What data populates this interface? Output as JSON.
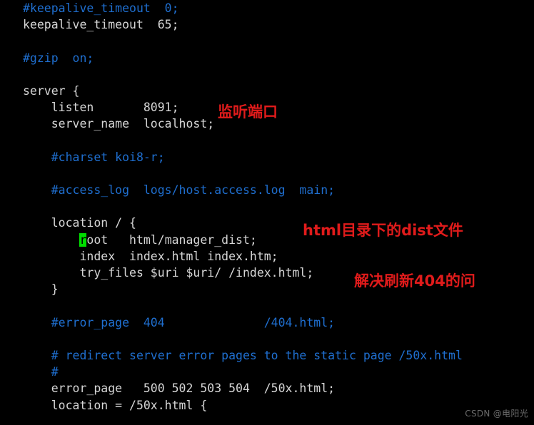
{
  "window": {
    "kind": "terminal-text-editor",
    "background_color": "#000000",
    "foreground_color": "#d6d6d6",
    "comment_color": "#1f6fd0",
    "annotation_color": "#e01b1b",
    "cursor_color": "#00dd00"
  },
  "code": {
    "lines": [
      {
        "indent": 0,
        "text": "#keepalive_timeout  0;",
        "style": "comment"
      },
      {
        "indent": 0,
        "text": "keepalive_timeout  65;",
        "style": "text"
      },
      {
        "indent": 0,
        "text": "",
        "style": "text"
      },
      {
        "indent": 0,
        "text": "#gzip  on;",
        "style": "comment"
      },
      {
        "indent": 0,
        "text": "",
        "style": "text"
      },
      {
        "indent": 0,
        "text": "server {",
        "style": "text"
      },
      {
        "indent": 4,
        "text": "listen       8091;",
        "style": "text"
      },
      {
        "indent": 4,
        "text": "server_name  localhost;",
        "style": "text"
      },
      {
        "indent": 0,
        "text": "",
        "style": "text"
      },
      {
        "indent": 4,
        "text": "#charset koi8-r;",
        "style": "comment"
      },
      {
        "indent": 0,
        "text": "",
        "style": "text"
      },
      {
        "indent": 4,
        "text": "#access_log  logs/host.access.log  main;",
        "style": "comment"
      },
      {
        "indent": 0,
        "text": "",
        "style": "text"
      },
      {
        "indent": 4,
        "text": "location / {",
        "style": "text"
      },
      {
        "indent": 8,
        "text": "root   html/manager_dist;",
        "style": "text",
        "cursor_at": 0
      },
      {
        "indent": 8,
        "text": "index  index.html index.htm;",
        "style": "text"
      },
      {
        "indent": 8,
        "text": "try_files $uri $uri/ /index.html;",
        "style": "text"
      },
      {
        "indent": 4,
        "text": "}",
        "style": "text"
      },
      {
        "indent": 0,
        "text": "",
        "style": "text"
      },
      {
        "indent": 4,
        "text": "#error_page  404              /404.html;",
        "style": "comment"
      },
      {
        "indent": 0,
        "text": "",
        "style": "text"
      },
      {
        "indent": 4,
        "text": "# redirect server error pages to the static page /50x.html",
        "style": "comment"
      },
      {
        "indent": 4,
        "text": "#",
        "style": "comment"
      },
      {
        "indent": 4,
        "text": "error_page   500 502 503 504  /50x.html;",
        "style": "text"
      },
      {
        "indent": 4,
        "text": "location = /50x.html {",
        "style": "text"
      }
    ]
  },
  "annotations": {
    "port": "监听端口",
    "dist": "html目录下的dist文件",
    "rewrite_404": "解决刷新404的问"
  },
  "watermark": {
    "text": "CSDN @电阳光"
  }
}
